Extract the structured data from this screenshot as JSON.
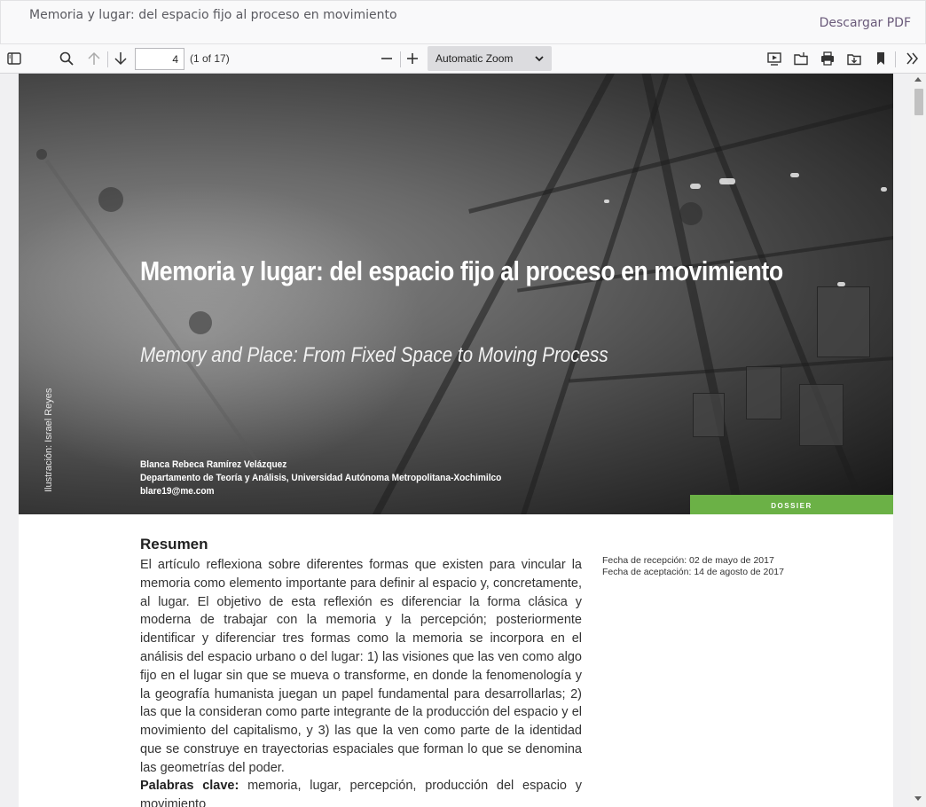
{
  "header": {
    "title": "Memoria y lugar: del espacio fijo al proceso en movimiento",
    "download_label": "Descargar PDF"
  },
  "toolbar": {
    "page_number": "4",
    "page_count": "(1 of 17)",
    "zoom": "Automatic Zoom",
    "icons": [
      "sidebar-toggle-icon",
      "search-icon",
      "arrow-up-icon",
      "arrow-down-icon",
      "zoom-out-icon",
      "zoom-in-icon",
      "presentation-icon",
      "open-file-icon",
      "print-icon",
      "download-icon",
      "bookmark-icon",
      "double-chevron-right-icon"
    ]
  },
  "article": {
    "title": "Memoria y lugar: del espacio fijo al proceso en movimiento",
    "subtitle": "Memory and Place: From Fixed Space to Moving Process",
    "author_name": "Blanca Rebeca Ramírez Velázquez",
    "author_dept": "Departamento de Teoría y Análisis, Universidad Autónoma Metropolitana-Xochimilco",
    "author_email": "blare19@me.com",
    "illustration_credit": "Ilustración: Israel Reyes",
    "section_tag": "DOSSIER",
    "abstract_heading": "Resumen",
    "abstract": "El artículo reflexiona sobre diferentes formas que existen para vincular la memoria como elemento importante para definir al espacio y, concretamente, al lugar. El objetivo de esta reflexión es diferenciar la forma clásica y moderna de trabajar con la memoria y la percepción; posteriormente identificar y diferenciar tres formas como la memoria se incorpora en el análisis del espacio urbano o del lugar: 1) las visiones que las ven como algo fijo en el lugar sin que se mueva o transforme, en donde la fenomenología y la geografía humanista juegan un papel fundamental para desarrollarlas; 2) las que la consideran como parte integrante de la producción del espacio y el movimiento del capitalismo, y 3) las que la ven como parte de la identidad que se construye en trayectorias espaciales que forman lo que se denomina las geometrías del poder.",
    "received": "Fecha de recepción: 02 de mayo de 2017",
    "accepted": "Fecha de aceptación: 14 de agosto de 2017",
    "keywords_label": "Palabras clave:",
    "keywords": "memoria, lugar, percepción, producción del espacio y movimiento"
  },
  "colors": {
    "accent_green": "#6bb146",
    "toolbar_bg": "#f9f9fa",
    "link_purple": "#6a5a7a"
  }
}
